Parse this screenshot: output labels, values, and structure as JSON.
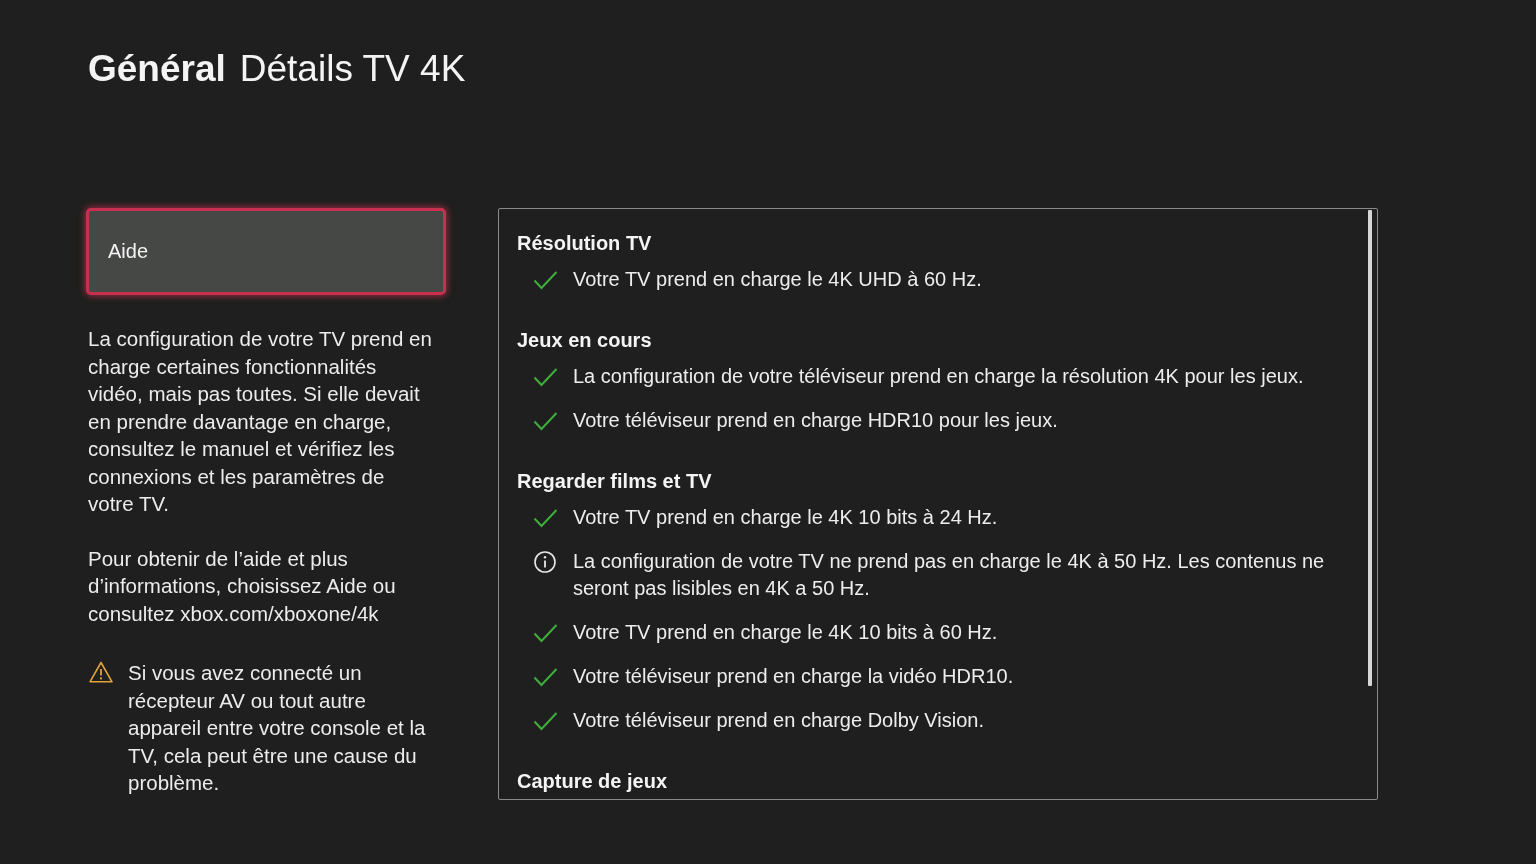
{
  "header": {
    "section": "Général",
    "title": "Détails TV 4K"
  },
  "help_button": {
    "label": "Aide",
    "focused": true
  },
  "description": [
    "La configuration de votre TV prend en charge certaines fonctionnalités vidéo, mais pas toutes. Si elle devait en prendre davantage en charge, consultez le manuel et vérifiez les connexions et les paramètres de votre TV.",
    "Pour obtenir de l’aide et plus d’informations, choisissez Aide ou consultez xbox.com/xboxone/4k"
  ],
  "warning": {
    "text": "Si vous avez connecté un récepteur AV ou tout autre appareil entre votre console et la TV, cela peut être une cause du problème."
  },
  "details": {
    "sections": [
      {
        "title": "Résolution TV",
        "items": [
          {
            "kind": "supported",
            "text": "Votre TV prend en charge le 4K UHD à 60 Hz."
          }
        ]
      },
      {
        "title": "Jeux en cours",
        "items": [
          {
            "kind": "supported",
            "text": "La configuration de votre téléviseur prend en charge la résolution 4K pour les jeux."
          },
          {
            "kind": "supported",
            "text": "Votre téléviseur prend en charge HDR10 pour les jeux."
          }
        ]
      },
      {
        "title": "Regarder films et TV",
        "items": [
          {
            "kind": "supported",
            "text": "Votre TV prend en charge le 4K 10 bits à 24 Hz."
          },
          {
            "kind": "info",
            "text": "La configuration de votre TV ne prend pas en charge le 4K à 50 Hz. Les contenus ne seront pas lisibles en 4K a 50 Hz."
          },
          {
            "kind": "supported",
            "text": "Votre TV prend en charge le 4K 10 bits à 60 Hz."
          },
          {
            "kind": "supported",
            "text": "Votre téléviseur prend en charge la vidéo HDR10."
          },
          {
            "kind": "supported",
            "text": "Votre téléviseur prend en charge Dolby Vision."
          }
        ]
      },
      {
        "title": "Capture de jeux"
      }
    ]
  }
}
